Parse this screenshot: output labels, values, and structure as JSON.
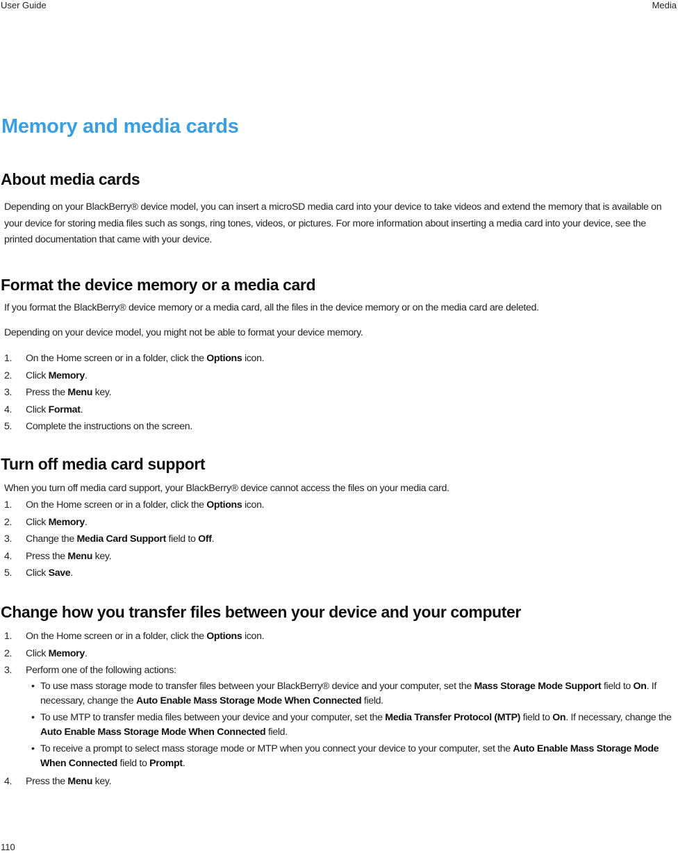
{
  "header": {
    "left": "User Guide",
    "right": "Media"
  },
  "footer": {
    "page_number": "110"
  },
  "title": "Memory and media cards",
  "sections": {
    "about": {
      "heading": "About media cards",
      "body": "Depending on your BlackBerry® device model, you can insert a microSD media card into your device to take videos and extend the memory that is available on your device for storing media files such as songs, ring tones, videos, or pictures. For more information about inserting a media card into your device, see the printed documentation that came with your device."
    },
    "format": {
      "heading": "Format the device memory or a media card",
      "para1": "If you format the BlackBerry® device memory or a media card, all the files in the device memory or on the media card are deleted.",
      "para2": "Depending on your device model, you might not be able to format your device memory.",
      "steps": [
        {
          "num": "1.",
          "pre": "On the Home screen or in a folder, click the ",
          "bold": "Options",
          "post": " icon."
        },
        {
          "num": "2.",
          "pre": "Click ",
          "bold": "Memory",
          "post": "."
        },
        {
          "num": "3.",
          "pre": "Press the ",
          "bold": "Menu",
          "post": " key."
        },
        {
          "num": "4.",
          "pre": "Click ",
          "bold": "Format",
          "post": "."
        },
        {
          "num": "5.",
          "pre": "Complete the instructions on the screen.",
          "bold": "",
          "post": ""
        }
      ]
    },
    "turnoff": {
      "heading": "Turn off media card support",
      "para": "When you turn off media card support, your BlackBerry® device cannot access the files on your media card.",
      "steps": [
        {
          "num": "1.",
          "pre": "On the Home screen or in a folder, click the ",
          "bold": "Options",
          "post": " icon."
        },
        {
          "num": "2.",
          "pre": "Click ",
          "bold": "Memory",
          "post": "."
        },
        {
          "num": "3.",
          "pre": "Change the ",
          "bold": "Media Card Support",
          "mid": " field to ",
          "bold2": "Off",
          "post": "."
        },
        {
          "num": "4.",
          "pre": "Press the ",
          "bold": "Menu",
          "post": " key."
        },
        {
          "num": "5.",
          "pre": "Click ",
          "bold": "Save",
          "post": "."
        }
      ]
    },
    "transfer": {
      "heading": "Change how you transfer files between your device and your computer",
      "steps": [
        {
          "num": "1.",
          "pre": "On the Home screen or in a folder, click the ",
          "bold": "Options",
          "post": " icon."
        },
        {
          "num": "2.",
          "pre": "Click ",
          "bold": "Memory",
          "post": "."
        },
        {
          "num": "3.",
          "pre": "Perform one of the following actions:"
        },
        {
          "num": "4.",
          "pre": "Press the ",
          "bold": "Menu",
          "post": " key."
        }
      ],
      "bullets": [
        {
          "a": "To use mass storage mode to transfer files between your BlackBerry® device and your computer, set the ",
          "b": "Mass Storage Mode Support",
          "c": " field to ",
          "d": "On",
          "e": ". If necessary, change the ",
          "f": "Auto Enable Mass Storage Mode When Connected",
          "g": " field."
        },
        {
          "a": "To use MTP to transfer media files between your device and your computer, set the ",
          "b": "Media Transfer Protocol (MTP)",
          "c": " field to ",
          "d": "On",
          "e": ". If necessary, change the ",
          "f": "Auto Enable Mass Storage Mode When Connected",
          "g": " field."
        },
        {
          "a": "To receive a prompt to select mass storage mode or MTP when you connect your device to your computer, set the ",
          "b": "Auto Enable Mass Storage Mode When Connected",
          "c": " field to ",
          "d": "Prompt",
          "e": ".",
          "f": "",
          "g": ""
        }
      ]
    }
  }
}
